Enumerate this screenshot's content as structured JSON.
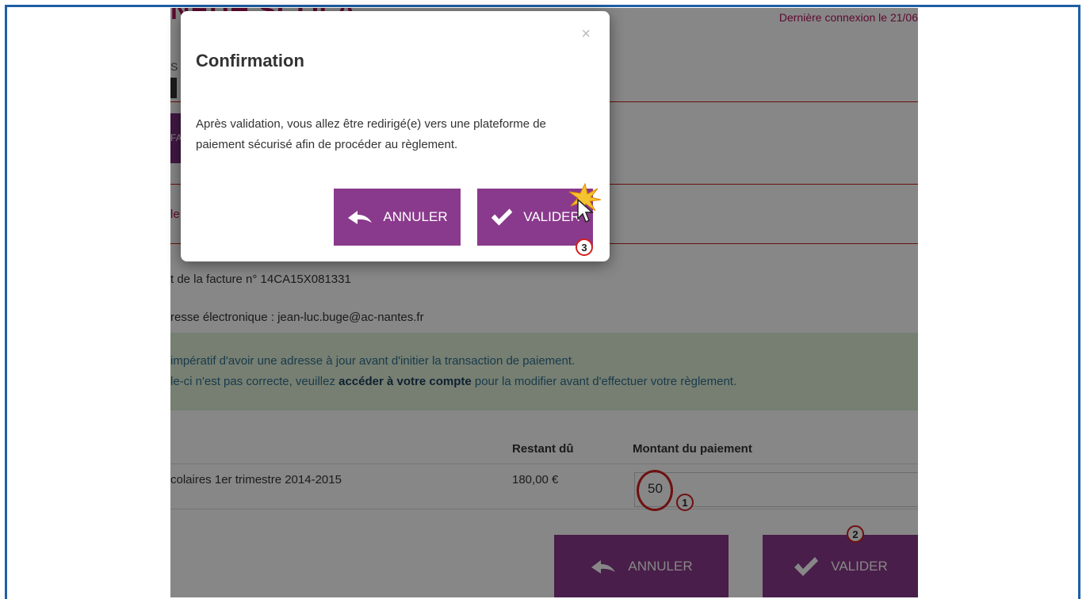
{
  "page": {
    "logo_fragment": "NEUH SCOLA",
    "last_login": "Dernière connexion le 21/06",
    "side_fragment_letter": "S",
    "tab_fragment": "FA",
    "label_fragment": "le",
    "invoice_line": "t de la facture n° 14CA15X081331",
    "email_line": "resse électronique : jean-luc.buge@ac-nantes.fr",
    "alert": {
      "line1": "impératif d'avoir une adresse à jour avant d'initier la transaction de paiement.",
      "line2_prefix": "le-ci n'est pas correcte, veuillez ",
      "line2_link": "accéder à votre compte",
      "line2_suffix": " pour la modifier avant d'effectuer votre règlement."
    },
    "table": {
      "headers": {
        "remaining": "Restant dû",
        "amount": "Montant du paiement"
      },
      "row": {
        "label": "colaires 1er trimestre 2014-2015",
        "remaining": "180,00 €",
        "amount_value": "50"
      }
    },
    "buttons": {
      "cancel": "ANNULER",
      "validate": "VALIDER"
    }
  },
  "modal": {
    "title": "Confirmation",
    "close": "×",
    "message": "Après validation, vous allez être redirigé(e) vers une plateforme de paiement sécurisé afin de procéder au règlement.",
    "cancel": "ANNULER",
    "validate": "VALIDER"
  },
  "annotations": {
    "step1": "1",
    "step2": "2",
    "step3": "3"
  },
  "colors": {
    "accent": "#8a3a8c",
    "brand": "#b0145a",
    "annotation": "#d21f1f",
    "frame": "#1f5fa5"
  }
}
